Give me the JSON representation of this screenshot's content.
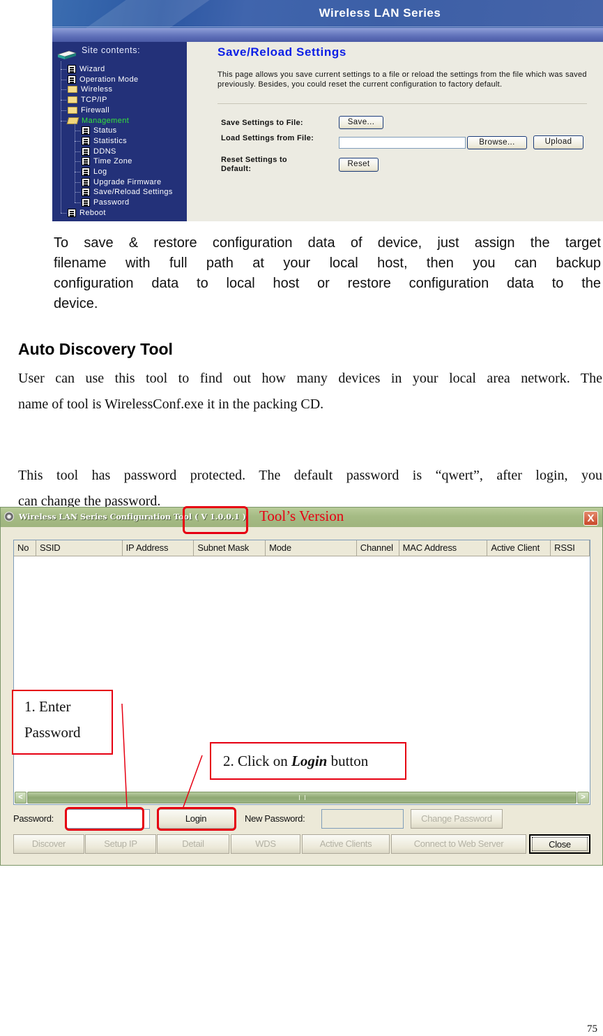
{
  "web_admin": {
    "banner_title": "Wireless LAN Series",
    "sidebar": {
      "heading": "Site contents:",
      "items": [
        {
          "label": "Wizard",
          "icon": "page-icon",
          "level": 0
        },
        {
          "label": "Operation Mode",
          "icon": "page-icon",
          "level": 0
        },
        {
          "label": "Wireless",
          "icon": "folder-icon",
          "level": 0
        },
        {
          "label": "TCP/IP",
          "icon": "folder-icon",
          "level": 0
        },
        {
          "label": "Firewall",
          "icon": "folder-icon",
          "level": 0
        },
        {
          "label": "Management",
          "icon": "folder-open-icon",
          "level": 0,
          "active": true
        },
        {
          "label": "Status",
          "icon": "page-icon",
          "level": 1
        },
        {
          "label": "Statistics",
          "icon": "page-icon",
          "level": 1
        },
        {
          "label": "DDNS",
          "icon": "page-icon",
          "level": 1
        },
        {
          "label": "Time Zone",
          "icon": "page-icon",
          "level": 1
        },
        {
          "label": "Log",
          "icon": "page-icon",
          "level": 1
        },
        {
          "label": "Upgrade Firmware",
          "icon": "page-icon",
          "level": 1
        },
        {
          "label": "Save/Reload Settings",
          "icon": "page-icon",
          "level": 1
        },
        {
          "label": "Password",
          "icon": "page-icon",
          "level": 1
        },
        {
          "label": "Reboot",
          "icon": "page-icon",
          "level": 0
        }
      ]
    },
    "page_title": "Save/Reload Settings",
    "page_description": "This page allows you save current settings to a file or reload the settings from the file which was saved previously. Besides, you could reset the current configuration to factory default.",
    "form": {
      "save_label": "Save Settings to File:",
      "save_button": "Save...",
      "load_label": "Load Settings from File:",
      "file_value": "",
      "browse_button": "Browse...",
      "upload_button": "Upload",
      "reset_label": "Reset Settings to Default:",
      "reset_button": "Reset"
    },
    "colors": {
      "sidebar_bg": "#233179",
      "active_item": "#35e33a",
      "title": "#0c1fe6"
    }
  },
  "document": {
    "intro_lines": [
      "To save & restore configuration data of device, just assign the target",
      "filename with full path at your local host, then you can backup",
      "configuration data to local host or restore configuration data to the",
      "device."
    ],
    "section_heading": "Auto Discovery Tool",
    "para1_lines": [
      "User can use this tool to find out how many devices in your local area network. The",
      "name of tool is WirelessConf.exe it in the packing CD."
    ],
    "para2_lines": [
      "This tool has password protected. The default password is “qwert”, after login, you",
      "can change the password."
    ],
    "page_number": "75"
  },
  "config_tool": {
    "window_title": "Wireless LAN Series Configuration Tool",
    "version": "( V 1.0.0.1 )",
    "close_glyph": "X",
    "columns": [
      "No",
      "SSID",
      "IP Address",
      "Subnet Mask",
      "Mode",
      "Channel",
      "MAC Address",
      "Active Client",
      "RSSI"
    ],
    "rows": [],
    "scroll_left": "<",
    "scroll_right": ">",
    "password_label": "Password:",
    "password_value": "",
    "login_button": "Login",
    "new_password_label": "New Password:",
    "new_password_value": "",
    "change_password_button": "Change Password",
    "bottom_buttons": [
      {
        "label": "Discover",
        "enabled": false
      },
      {
        "label": "Setup IP",
        "enabled": false
      },
      {
        "label": "Detail",
        "enabled": false
      },
      {
        "label": "WDS",
        "enabled": false
      },
      {
        "label": "Active Clients",
        "enabled": false
      },
      {
        "label": "Connect to Web Server",
        "enabled": false
      },
      {
        "label": "Close",
        "enabled": true,
        "default": true
      }
    ]
  },
  "annotations": {
    "version_label": "Tool’s Version",
    "step1_line1": "1. Enter",
    "step1_line2": "Password",
    "step2_prefix": "2. Click on ",
    "step2_emph": "Login",
    "step2_suffix": " button",
    "color": "#e60012"
  }
}
